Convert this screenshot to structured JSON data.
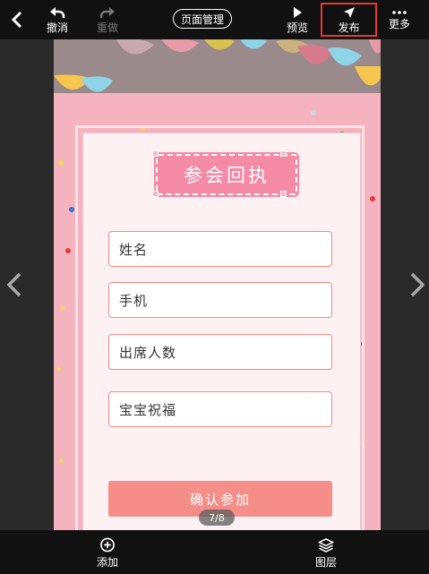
{
  "toolbar": {
    "back_icon": "chevron-left-icon",
    "undo_label": "撤消",
    "redo_label": "重做",
    "page_manage_label": "页面管理",
    "preview_label": "预览",
    "publish_label": "发布",
    "more_label": "更多"
  },
  "canvas": {
    "title": "参会回执",
    "fields": [
      {
        "placeholder": "姓名"
      },
      {
        "placeholder": "手机"
      },
      {
        "placeholder": "出席人数"
      },
      {
        "placeholder": "宝宝祝福"
      }
    ],
    "confirm_label": "确认参加",
    "page_indicator": "7/8"
  },
  "bottom": {
    "add_label": "添加",
    "layers_label": "图层"
  },
  "colors": {
    "accent_red": "#e53935",
    "page_pink": "#f5b3c0",
    "badge_pink": "#f48aa5",
    "field_border": "#f28b82",
    "button_salmon": "#f58e88"
  }
}
